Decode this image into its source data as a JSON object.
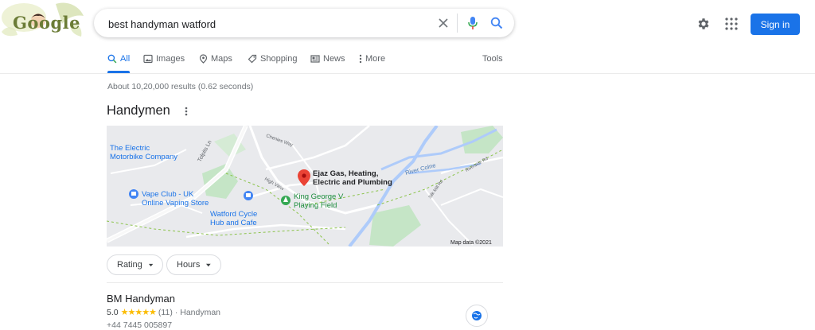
{
  "search": {
    "query": "best handyman watford"
  },
  "logo": {
    "text": "Google"
  },
  "header": {
    "signin_label": "Sign in"
  },
  "tabs": [
    {
      "label": "All",
      "icon": "search-icon",
      "active": true
    },
    {
      "label": "Images",
      "icon": "image-icon"
    },
    {
      "label": "Maps",
      "icon": "map-pin-icon"
    },
    {
      "label": "Shopping",
      "icon": "tag-icon"
    },
    {
      "label": "News",
      "icon": "news-icon"
    },
    {
      "label": "More",
      "icon": "more-vert-icon"
    }
  ],
  "tools_label": "Tools",
  "results_stats": "About 10,20,000 results (0.62 seconds)",
  "section": {
    "title": "Handymen"
  },
  "map": {
    "labels": {
      "electric_1": "The Electric",
      "electric_2": "Motorbike Company",
      "vape_1": "Vape Club - UK",
      "vape_2": "Online Vaping Store",
      "cycle_1": "Watford Cycle",
      "cycle_2": "Hub and Cafe",
      "ejaz_1": "Ejaz Gas, Heating,",
      "ejaz_2": "Electric and Plumbing",
      "george_1": "King George V",
      "george_2": "Playing Field",
      "river": "River Colne",
      "road_tolpits": "Tolpits Ln",
      "road_high": "High View",
      "road_chenies": "Chenies Way",
      "road_silk": "Silk Mill Rd",
      "road_riverside": "Riverside Rd",
      "credit": "Map data ©2021"
    }
  },
  "filters": [
    {
      "label": "Rating"
    },
    {
      "label": "Hours"
    }
  ],
  "business": {
    "name": "BM Handyman",
    "rating": "5.0",
    "stars": "★★★★★",
    "reviews": "(11)",
    "category": "· Handyman",
    "phone": "+44 7445 005897"
  },
  "colors": {
    "accent": "#1a73e8",
    "star": "#fbbc04",
    "map_pin": "#ea4335",
    "park": "#c5e5c6",
    "water": "#aecbfa"
  }
}
